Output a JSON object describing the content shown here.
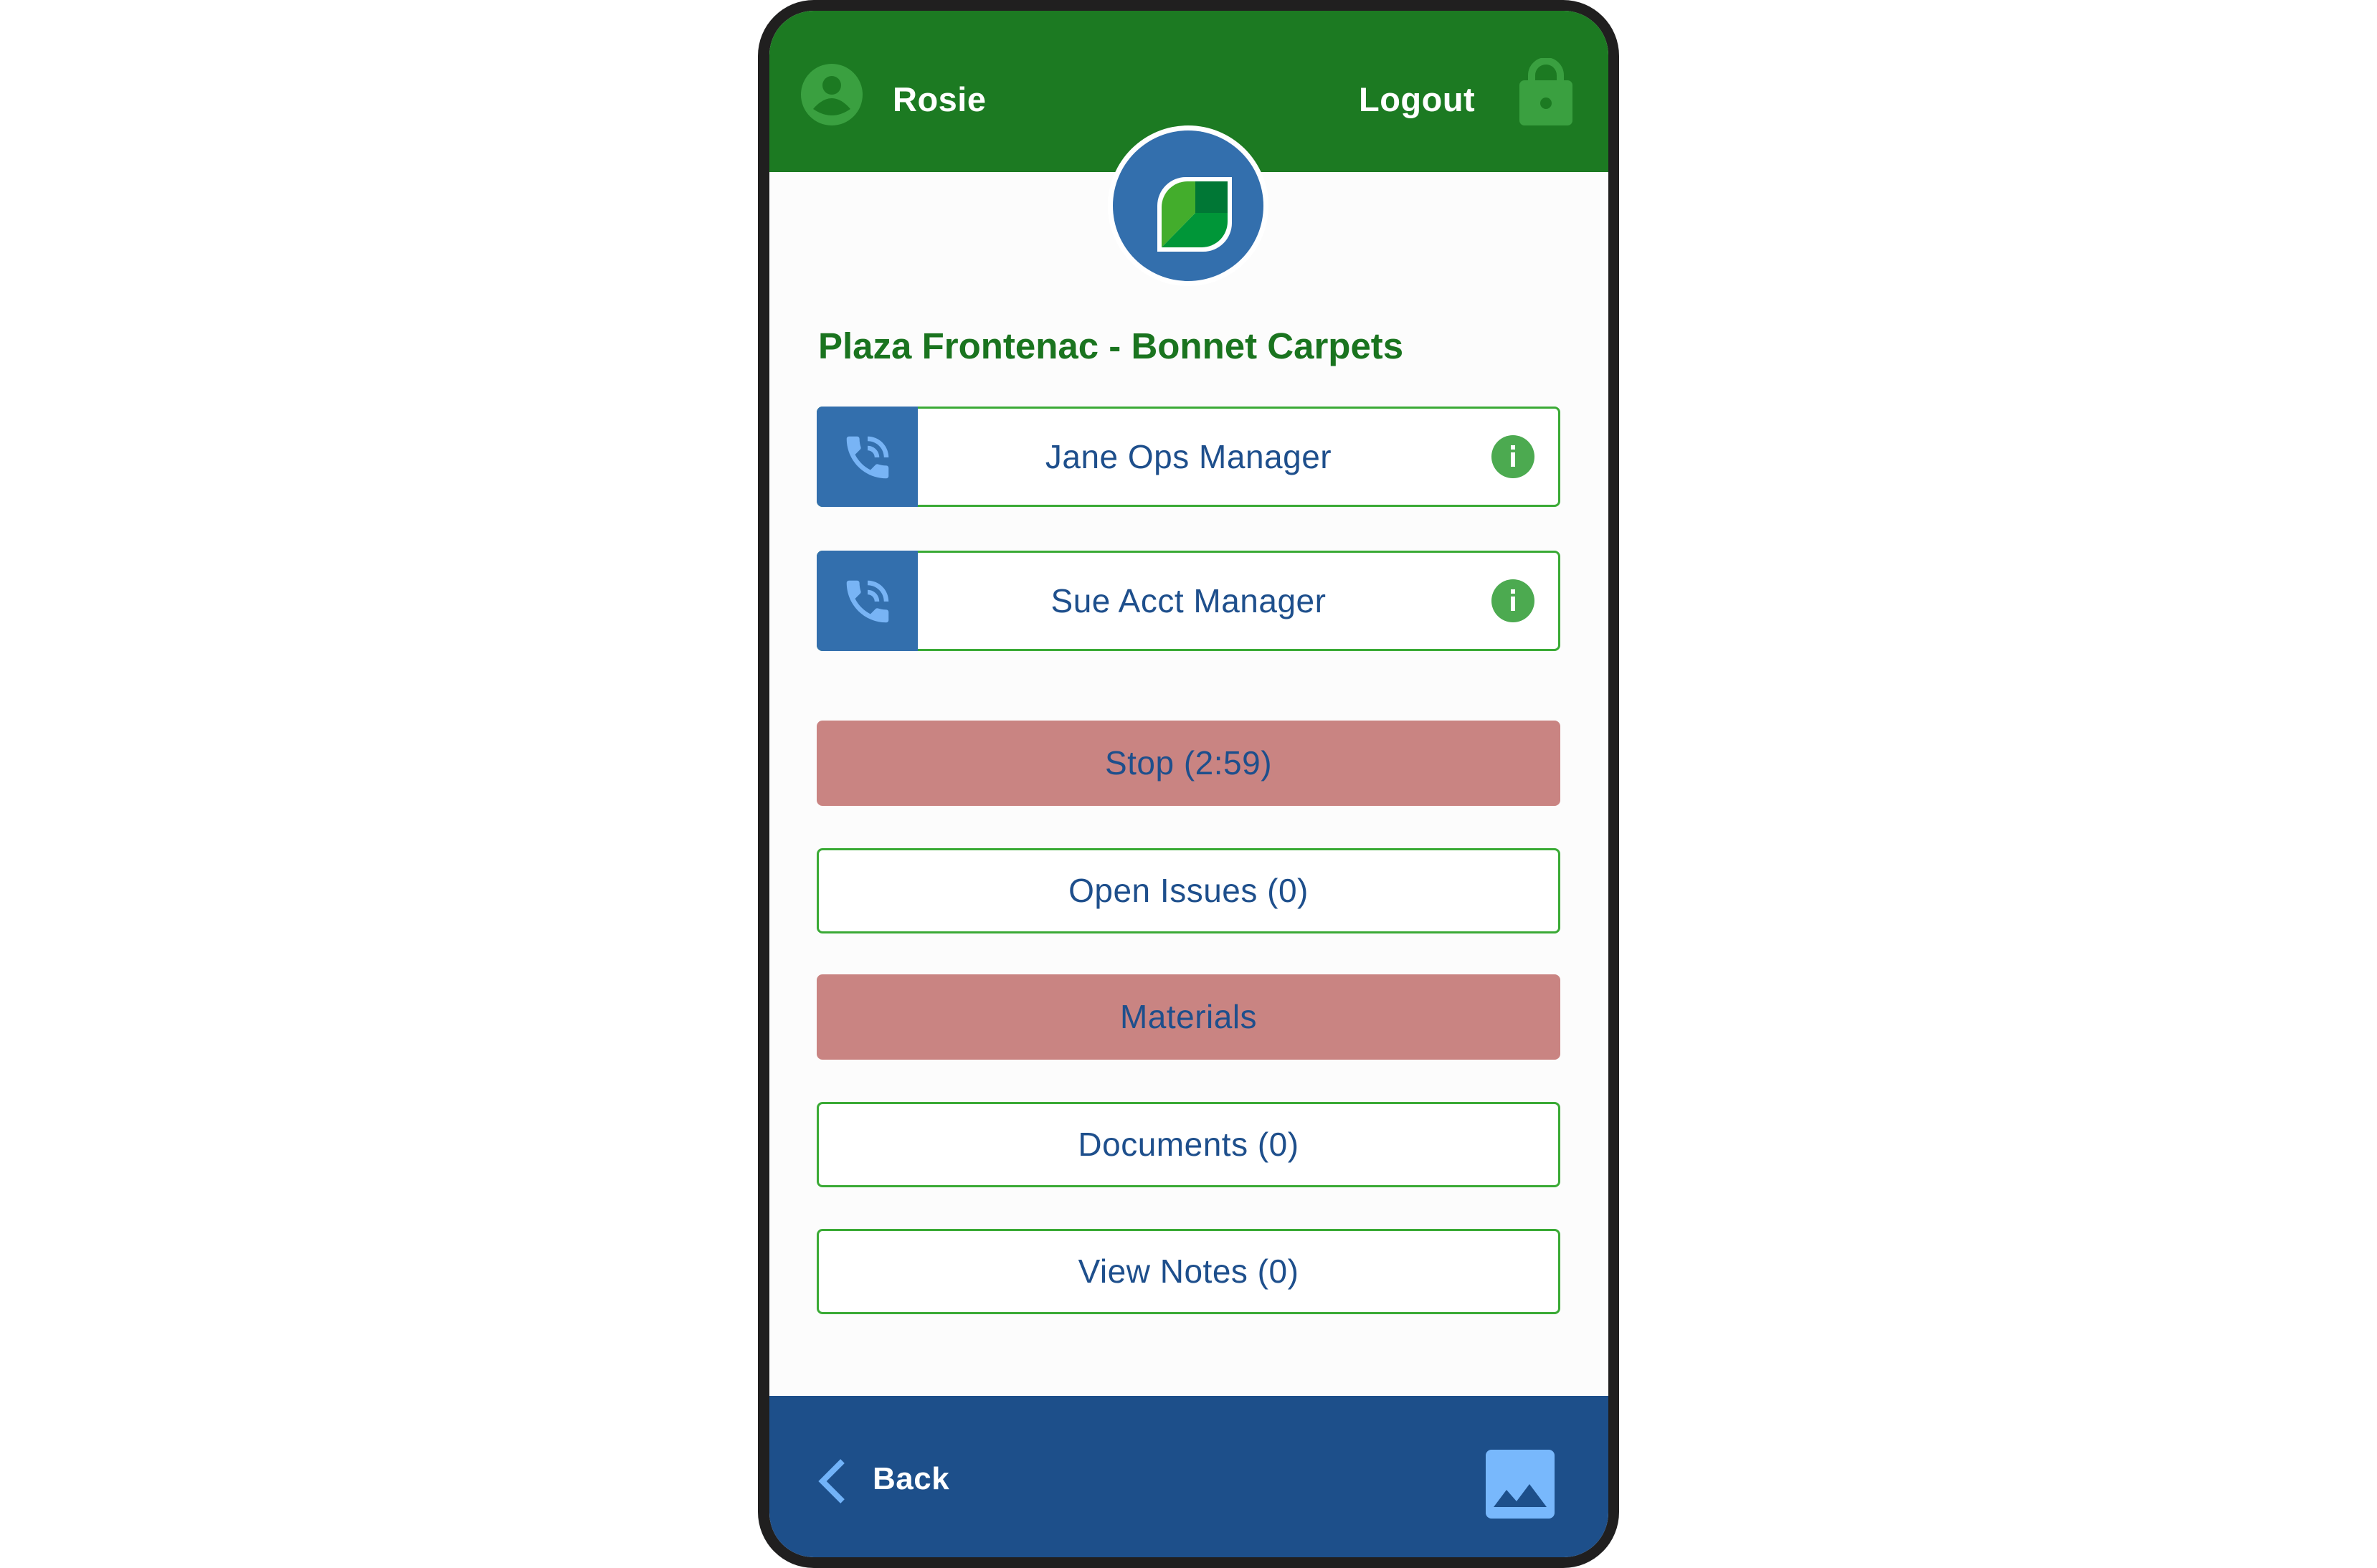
{
  "header": {
    "user_name": "Rosie",
    "logout_label": "Logout",
    "icons": {
      "user": "account-circle-icon",
      "logout": "lock-icon"
    }
  },
  "logo": {
    "icon": "leaf-logo-icon"
  },
  "page": {
    "title": "Plaza Frontenac - Bonnet Carpets"
  },
  "contacts": [
    {
      "name": "Jane Ops Manager",
      "call_icon": "phone-call-icon",
      "info_icon": "info-icon"
    },
    {
      "name": "Sue Acct Manager",
      "call_icon": "phone-call-icon",
      "info_icon": "info-icon"
    }
  ],
  "actions": [
    {
      "label": "Stop (2:59)",
      "style": "filled"
    },
    {
      "label": "Open Issues (0)",
      "style": "outline"
    },
    {
      "label": "Materials",
      "style": "filled"
    },
    {
      "label": "Documents (0)",
      "style": "outline"
    },
    {
      "label": "View Notes (0)",
      "style": "outline"
    }
  ],
  "footer": {
    "back_label": "Back",
    "icons": {
      "back": "chevron-left-icon",
      "gallery": "image-icon"
    }
  },
  "colors": {
    "header_green": "#1c7a22",
    "title_green": "#1a741f",
    "border_green": "#3aaa35",
    "accent_blue": "#336fad",
    "text_blue": "#1e4f8c",
    "footer_blue": "#1d4f8a",
    "alert_red": "#c98482"
  }
}
